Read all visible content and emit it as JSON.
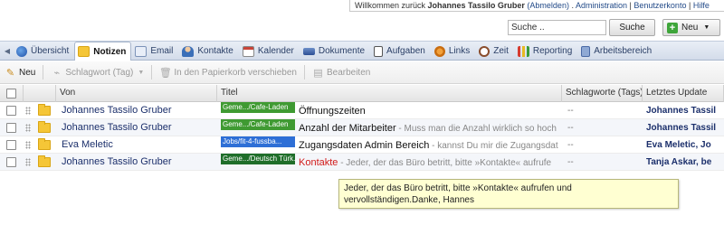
{
  "topbar": {
    "welcome_prefix": "Willkommen zurück",
    "user_name": "Johannes Tassilo Gruber",
    "logout": "(Abmelden)",
    "sep1": ".",
    "admin": "Administration",
    "sep2": "|",
    "account": "Benutzerkonto",
    "sep3": "|",
    "help": "Hilfe"
  },
  "search": {
    "placeholder": "Suche ..",
    "value": "Suche ..",
    "button": "Suche"
  },
  "new_button": {
    "label": "Neu"
  },
  "tabs": [
    {
      "label": "Übersicht",
      "icon": "globe-icon"
    },
    {
      "label": "Notizen",
      "icon": "folder-icon",
      "active": true
    },
    {
      "label": "Email",
      "icon": "envelope-icon"
    },
    {
      "label": "Kontakte",
      "icon": "person-icon"
    },
    {
      "label": "Kalender",
      "icon": "calendar-icon"
    },
    {
      "label": "Dokumente",
      "icon": "drive-icon"
    },
    {
      "label": "Aufgaben",
      "icon": "clipboard-icon"
    },
    {
      "label": "Links",
      "icon": "link-icon"
    },
    {
      "label": "Zeit",
      "icon": "clock-icon"
    },
    {
      "label": "Reporting",
      "icon": "bar-chart-icon"
    },
    {
      "label": "Arbeitsbereich",
      "icon": "workspace-icon"
    }
  ],
  "toolbar": {
    "new": "Neu",
    "tag": "Schlagwort (Tag)",
    "trash": "In den Papierkorb verschieben",
    "edit": "Bearbeiten"
  },
  "grid": {
    "headers": {
      "von": "Von",
      "titel": "Titel",
      "tags": "Schlagworte (Tags)",
      "updated": "Letztes Update"
    },
    "rows": [
      {
        "von": "Johannes Tassilo Gruber",
        "tag": "Geme.../Cafe-Laden",
        "title": "Öffnungszeiten",
        "snippet": "",
        "tags": "--",
        "updated": "Johannes Tassil"
      },
      {
        "von": "Johannes Tassilo Gruber",
        "tag": "Geme.../Cafe-Laden",
        "title": "Anzahl der Mitarbeiter",
        "snippet": " - Muss man die Anzahl wirklich so hoch",
        "tags": "--",
        "updated": "Johannes Tassil"
      },
      {
        "von": "Eva Meletic",
        "tag": "Jobs/fit-4-fussba...",
        "title": "Zugangsdaten Admin Bereich",
        "snippet": " - kannst Du mir die Zugangsdat",
        "tags": "--",
        "updated": "Eva Meletic, Jo"
      },
      {
        "von": "Johannes Tassilo Gruber",
        "tag": "Geme.../Deutsch Türk...",
        "title": "Kontakte",
        "snippet": " - Jeder, der das Büro betritt, bitte »Kontakte« aufrufe",
        "tags": "--",
        "updated": "Tanja Askar, be"
      }
    ]
  },
  "tooltip": {
    "line1": "Jeder, der das Büro betritt, bitte »Kontakte« aufrufen und",
    "line2": "vervollständigen.Danke, Hannes"
  },
  "colors": {
    "tag_green": "#3f9a32",
    "tag_blue": "#2e6fd6",
    "tag_dark_green": "#1f6e2a",
    "alert_red": "#d11b1b",
    "tooltip_bg": "#ffffd2"
  }
}
